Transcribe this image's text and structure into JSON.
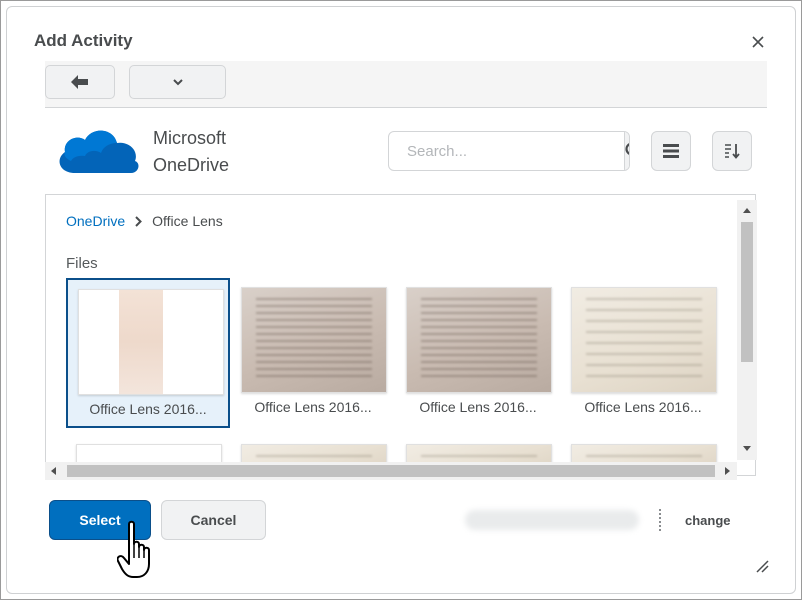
{
  "dialog": {
    "title": "Add Activity",
    "close_label": "×"
  },
  "provider": {
    "name_line1": "Microsoft",
    "name_line2": "OneDrive",
    "brand_color": "#0364b8"
  },
  "search": {
    "placeholder": "Search...",
    "value": ""
  },
  "breadcrumb": {
    "root": "OneDrive",
    "current": "Office Lens"
  },
  "files": {
    "heading": "Files",
    "items": [
      {
        "label": "Office Lens 2016...",
        "selected": true
      },
      {
        "label": "Office Lens 2016..."
      },
      {
        "label": "Office Lens 2016..."
      },
      {
        "label": "Office Lens 2016..."
      }
    ]
  },
  "footer": {
    "select_label": "Select",
    "cancel_label": "Cancel",
    "change_label": "change"
  },
  "colors": {
    "primary": "#006fbf",
    "selected_border": "#0b4f8a",
    "link": "#006fbf"
  },
  "icons": {
    "back": "arrow-left-icon",
    "menu": "chevron-down-icon",
    "search": "search-icon",
    "list_view": "list-view-icon",
    "sort": "sort-icon",
    "close": "close-icon"
  }
}
